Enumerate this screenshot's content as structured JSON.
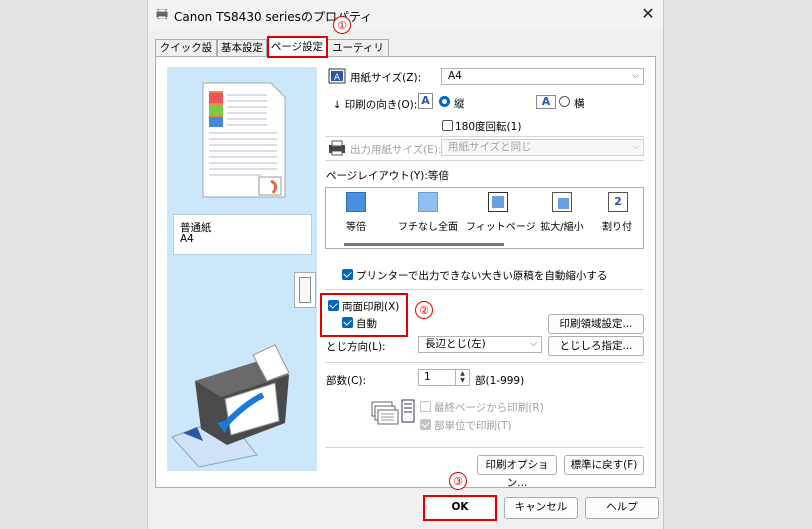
{
  "window": {
    "title": "Canon TS8430 seriesのプロパティ",
    "close_glyph": "✕"
  },
  "tabs": [
    {
      "label": "クイック設定"
    },
    {
      "label": "基本設定"
    },
    {
      "label": "ページ設定"
    },
    {
      "label": "ユーティリティ"
    }
  ],
  "preview": {
    "media_name": "普通紙",
    "media_size": "A4"
  },
  "paper_size": {
    "label": "用紙サイズ(Z):",
    "value": "A4"
  },
  "orientation": {
    "label": "印刷の向き(O):",
    "portrait_label": "縦",
    "landscape_label": "横",
    "selected": "portrait",
    "icon_glyph": "A",
    "rotate180_label": "180度回転(1)",
    "rotate180_checked": false
  },
  "output_paper": {
    "label": "出力用紙サイズ(E):",
    "value": "用紙サイズと同じ"
  },
  "page_layout": {
    "label": "ページレイアウト(Y):等倍",
    "items": [
      {
        "label": "等倍"
      },
      {
        "label": "フチなし全面"
      },
      {
        "label": "フィットページ"
      },
      {
        "label": "拡大/縮小"
      },
      {
        "label": "割り付"
      }
    ],
    "page_number_glyph": "2"
  },
  "auto_reduce": {
    "label": "プリンターで出力できない大きい原稿を自動縮小する",
    "checked": true
  },
  "duplex": {
    "label": "両面印刷(X)",
    "checked": true,
    "auto_label": "自動",
    "auto_checked": true
  },
  "print_area_button": "印刷領域設定...",
  "binding": {
    "label": "とじ方向(L):",
    "value": "長辺とじ(左)",
    "margin_button": "とじしろ指定..."
  },
  "copies": {
    "label": "部数(C):",
    "value": "1",
    "range": "部(1-999)",
    "reverse_label": "最終ページから印刷(R)",
    "reverse_checked": false,
    "collate_label": "部単位で印刷(T)",
    "collate_checked": true
  },
  "options_button": "印刷オプション...",
  "defaults_button": "標準に戻す(F)",
  "footer": {
    "ok": "OK",
    "cancel": "キャンセル",
    "help": "ヘルプ"
  },
  "annotations": [
    "①",
    "②",
    "③"
  ],
  "colors": {
    "accent": "#0067c0",
    "highlight": "#e00000",
    "preview_bg": "#cce6fa"
  }
}
